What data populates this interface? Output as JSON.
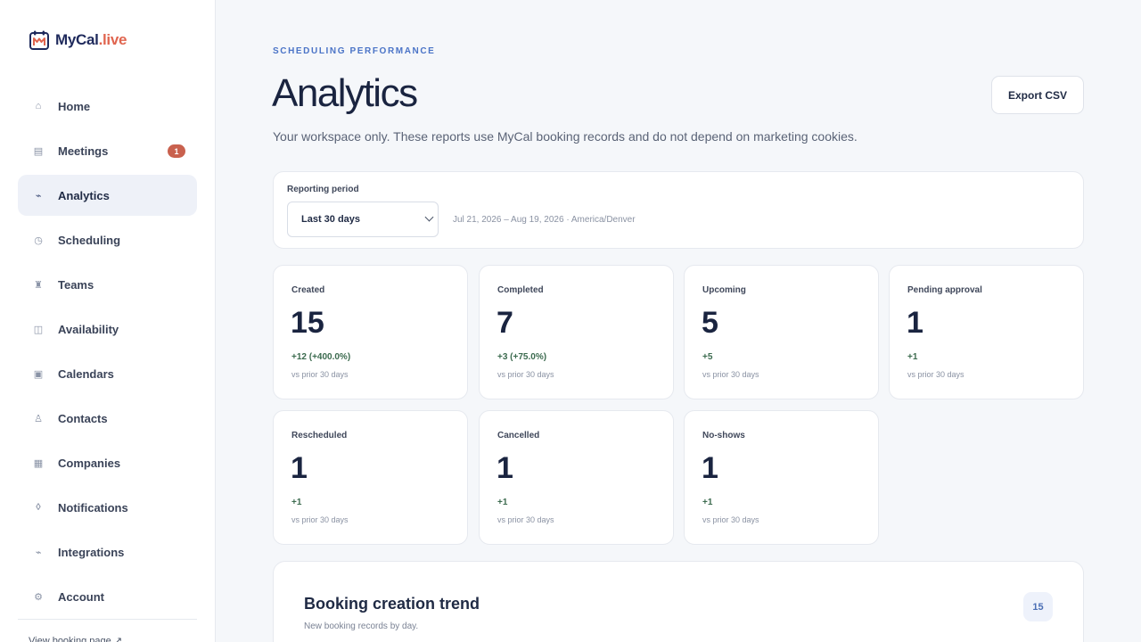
{
  "app": {
    "logo_text_main": "MyCal",
    "logo_text_accent": ".live"
  },
  "sidebar": {
    "items": [
      {
        "label": "Home",
        "icon": "home-icon",
        "glyph": "⌂"
      },
      {
        "label": "Meetings",
        "icon": "meetings-icon",
        "glyph": "▤",
        "badge": "1"
      },
      {
        "label": "Analytics",
        "icon": "analytics-icon",
        "glyph": "⌁",
        "active": true
      },
      {
        "label": "Scheduling",
        "icon": "clock-icon",
        "glyph": "◷"
      },
      {
        "label": "Teams",
        "icon": "teams-icon",
        "glyph": "♜"
      },
      {
        "label": "Availability",
        "icon": "availability-icon",
        "glyph": "◫"
      },
      {
        "label": "Calendars",
        "icon": "calendar-icon",
        "glyph": "▣"
      },
      {
        "label": "Contacts",
        "icon": "contacts-icon",
        "glyph": "♙"
      },
      {
        "label": "Companies",
        "icon": "companies-icon",
        "glyph": "▦"
      },
      {
        "label": "Notifications",
        "icon": "bell-icon",
        "glyph": "◊"
      },
      {
        "label": "Integrations",
        "icon": "integrations-icon",
        "glyph": "⌁"
      },
      {
        "label": "Account",
        "icon": "gear-icon",
        "glyph": "⚙"
      }
    ],
    "booking_link": "View booking page ↗"
  },
  "header": {
    "eyebrow": "SCHEDULING PERFORMANCE",
    "title": "Analytics",
    "subtitle": "Your workspace only. These reports use MyCal booking records and do not depend on marketing cookies.",
    "export_label": "Export CSV"
  },
  "period": {
    "label": "Reporting period",
    "selected": "Last 30 days",
    "range": "Jul 21, 2026 – Aug 19, 2026 · America/Denver"
  },
  "stats": [
    {
      "label": "Created",
      "value": "15",
      "delta": "+12 (+400.0%)",
      "compare": "vs prior 30 days"
    },
    {
      "label": "Completed",
      "value": "7",
      "delta": "+3 (+75.0%)",
      "compare": "vs prior 30 days"
    },
    {
      "label": "Upcoming",
      "value": "5",
      "delta": "+5",
      "compare": "vs prior 30 days"
    },
    {
      "label": "Pending approval",
      "value": "1",
      "delta": "+1",
      "compare": "vs prior 30 days"
    },
    {
      "label": "Rescheduled",
      "value": "1",
      "delta": "+1",
      "compare": "vs prior 30 days"
    },
    {
      "label": "Cancelled",
      "value": "1",
      "delta": "+1",
      "compare": "vs prior 30 days"
    },
    {
      "label": "No-shows",
      "value": "1",
      "delta": "+1",
      "compare": "vs prior 30 days"
    }
  ],
  "trend": {
    "title": "Booking creation trend",
    "subtitle": "New booking records by day.",
    "count": "15"
  },
  "colors": {
    "accent": "#4b74c7",
    "badge": "#c9614e",
    "delta_positive": "#3c6b4f",
    "logo_accent": "#e0654f"
  }
}
